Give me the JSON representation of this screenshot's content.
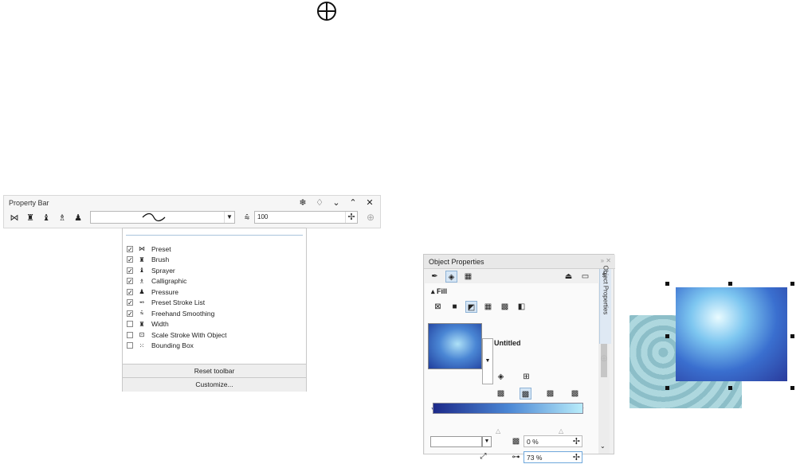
{
  "property_bar": {
    "title": "Property Bar",
    "header_controls": [
      "snowflake-icon",
      "lightbulb-icon",
      "chevron-down-icon",
      "chevron-up-icon",
      "close-icon"
    ],
    "tools": [
      "preset",
      "brush",
      "sprayer",
      "calligraphic",
      "pressure"
    ],
    "smoothing_value": "100"
  },
  "menu": {
    "items": [
      {
        "label": "Preset",
        "checked": true
      },
      {
        "label": "Brush",
        "checked": true
      },
      {
        "label": "Sprayer",
        "checked": true
      },
      {
        "label": "Calligraphic",
        "checked": true
      },
      {
        "label": "Pressure",
        "checked": true
      },
      {
        "label": "Preset Stroke List",
        "checked": true
      },
      {
        "label": "Freehand Smoothing",
        "checked": true
      },
      {
        "label": "Width",
        "checked": false
      },
      {
        "label": "Scale Stroke With Object",
        "checked": false
      },
      {
        "label": "Bounding Box",
        "checked": false
      }
    ],
    "reset_label": "Reset toolbar",
    "customize_label": "Customize..."
  },
  "object_properties": {
    "title": "Object Properties",
    "tab_label": "Object Properties",
    "section_label": "Fill",
    "fill_name": "Untitled",
    "transparency_value": "0 %",
    "second_value": "73 %"
  },
  "colors": {
    "accent": "#4a86d4",
    "gradient_dark": "#1f3d9c",
    "gradient_light": "#aee1f7",
    "pattern": "#7fb7c2"
  }
}
